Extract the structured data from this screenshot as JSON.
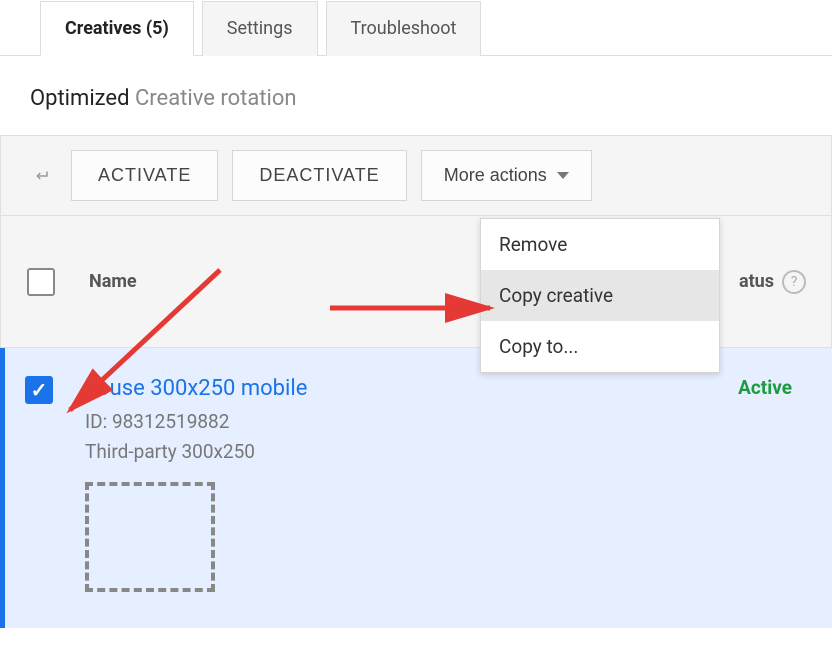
{
  "tabs": [
    {
      "label": "Creatives (5)",
      "active": true
    },
    {
      "label": "Settings",
      "active": false
    },
    {
      "label": "Troubleshoot",
      "active": false
    }
  ],
  "subtitle": {
    "strong": "Optimized",
    "muted": "Creative rotation"
  },
  "actions": {
    "activate": "ACTIVATE",
    "deactivate": "DEACTIVATE",
    "more": "More actions"
  },
  "dropdown": [
    {
      "label": "Remove",
      "highlight": false
    },
    {
      "label": "Copy creative",
      "highlight": true
    },
    {
      "label": "Copy to...",
      "highlight": false
    }
  ],
  "columns": {
    "name": "Name",
    "status": "atus"
  },
  "row": {
    "title": "house 300x250 mobile",
    "id_line": "ID: 98312519882",
    "type_line": "Third-party 300x250",
    "status": "Active",
    "checked": true
  }
}
